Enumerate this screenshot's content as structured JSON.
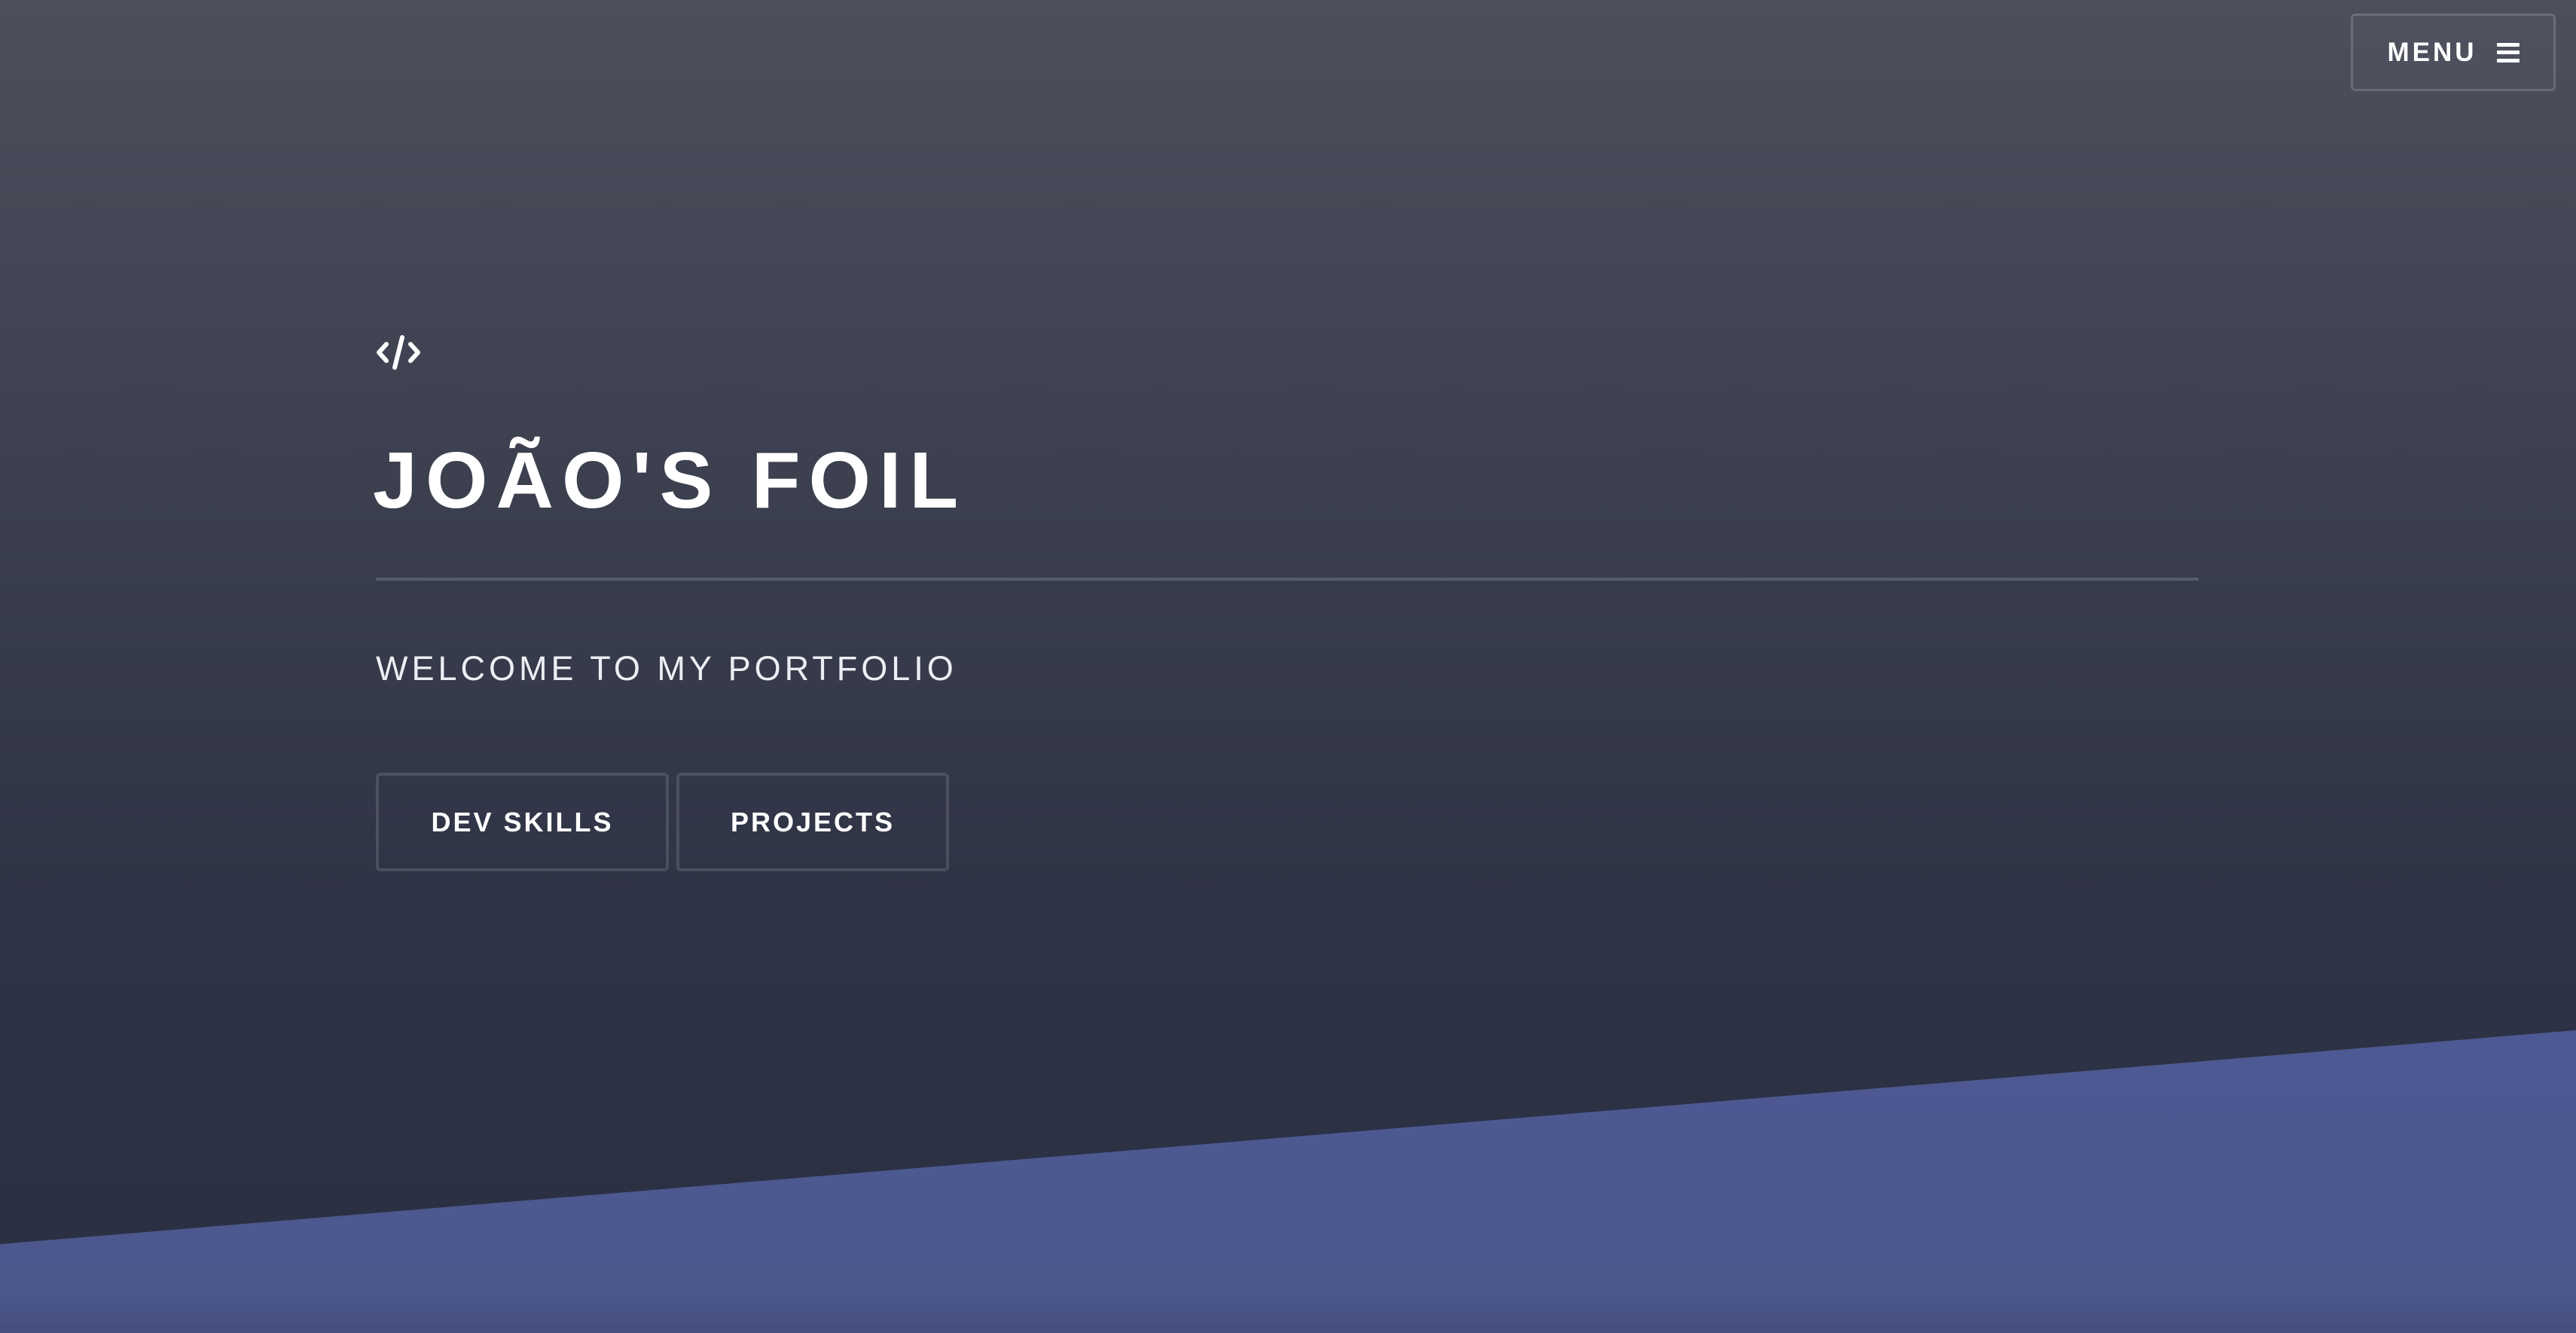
{
  "header": {
    "menu_label": "MENU",
    "menu_icon": "hamburger-icon"
  },
  "hero": {
    "logo_icon": "code-icon",
    "title": "JOÃO'S FOIL",
    "subtitle": "WELCOME TO MY PORTFOLIO",
    "buttons": [
      {
        "label": "DEV SKILLS"
      },
      {
        "label": "PROJECTS"
      }
    ]
  },
  "colors": {
    "background_top": "#4d4f5c",
    "background_bottom": "#2a2f42",
    "accent": "#4c578c",
    "text": "#ffffff"
  }
}
